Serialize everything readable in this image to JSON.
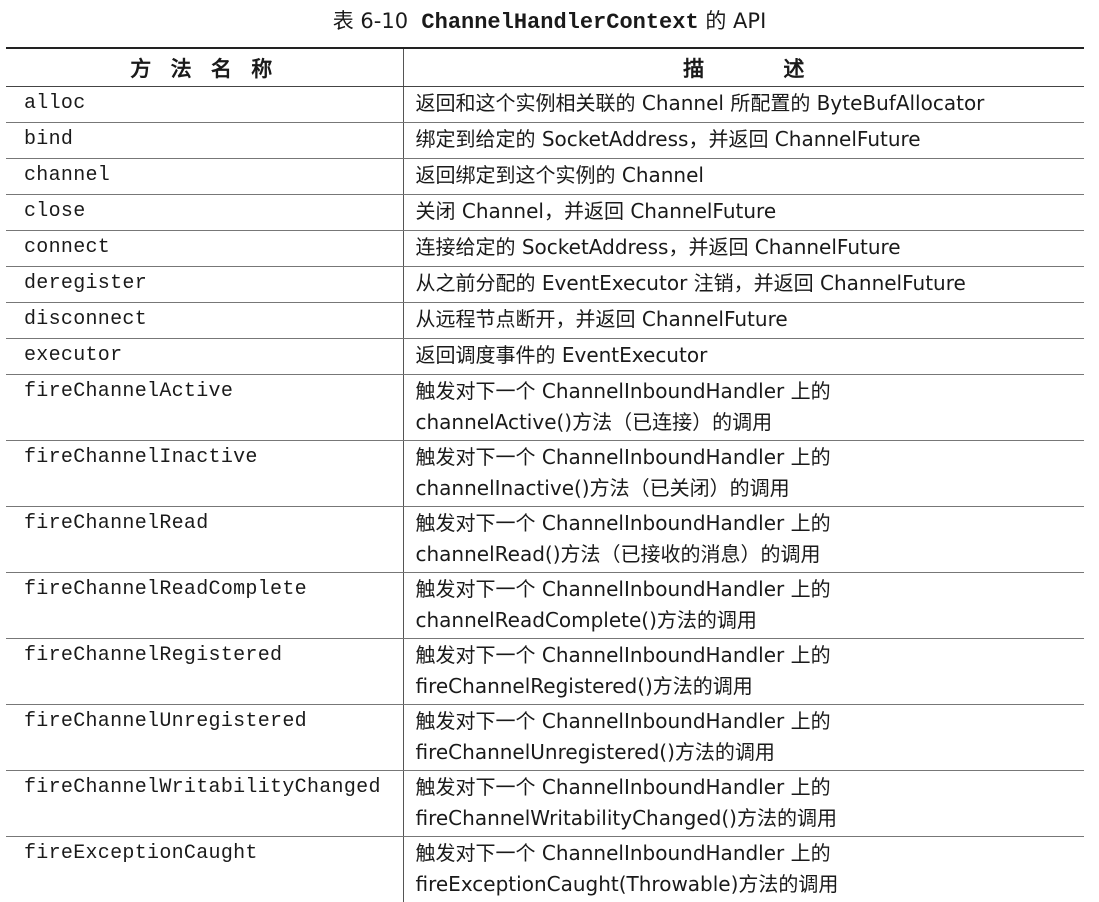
{
  "caption": {
    "number": "表 6-10",
    "code": "ChannelHandlerContext",
    "suffix": "的 API"
  },
  "columns": {
    "method": "方 法 名 称",
    "description": "描 述"
  },
  "rows": [
    {
      "method": "alloc",
      "desc": [
        "返回和这个实例相关联的 Channel 所配置的 ByteBufAllocator"
      ]
    },
    {
      "method": "bind",
      "desc": [
        "绑定到给定的 SocketAddress，并返回 ChannelFuture"
      ]
    },
    {
      "method": "channel",
      "desc": [
        "返回绑定到这个实例的 Channel"
      ]
    },
    {
      "method": "close",
      "desc": [
        "关闭 Channel，并返回 ChannelFuture"
      ]
    },
    {
      "method": "connect",
      "desc": [
        "连接给定的 SocketAddress，并返回 ChannelFuture"
      ]
    },
    {
      "method": "deregister",
      "desc": [
        "从之前分配的 EventExecutor 注销，并返回 ChannelFuture"
      ]
    },
    {
      "method": "disconnect",
      "desc": [
        "从远程节点断开，并返回 ChannelFuture"
      ]
    },
    {
      "method": "executor",
      "desc": [
        "返回调度事件的 EventExecutor"
      ]
    },
    {
      "method": "fireChannelActive",
      "desc": [
        "触发对下一个 ChannelInboundHandler 上的",
        "channelActive()方法（已连接）的调用"
      ]
    },
    {
      "method": "fireChannelInactive",
      "desc": [
        "触发对下一个 ChannelInboundHandler 上的",
        "channelInactive()方法（已关闭）的调用"
      ]
    },
    {
      "method": "fireChannelRead",
      "desc": [
        "触发对下一个 ChannelInboundHandler 上的",
        "channelRead()方法（已接收的消息）的调用"
      ]
    },
    {
      "method": "fireChannelReadComplete",
      "desc": [
        "触发对下一个 ChannelInboundHandler 上的",
        "channelReadComplete()方法的调用"
      ]
    },
    {
      "method": "fireChannelRegistered",
      "desc": [
        "触发对下一个 ChannelInboundHandler 上的",
        "fireChannelRegistered()方法的调用"
      ]
    },
    {
      "method": "fireChannelUnregistered",
      "desc": [
        "触发对下一个 ChannelInboundHandler 上的",
        "fireChannelUnregistered()方法的调用"
      ]
    },
    {
      "method": "fireChannelWritabilityChanged",
      "desc": [
        "触发对下一个 ChannelInboundHandler 上的",
        "fireChannelWritabilityChanged()方法的调用"
      ]
    },
    {
      "method": "fireExceptionCaught",
      "desc": [
        "触发对下一个 ChannelInboundHandler 上的",
        "fireExceptionCaught(Throwable)方法的调用"
      ]
    }
  ]
}
